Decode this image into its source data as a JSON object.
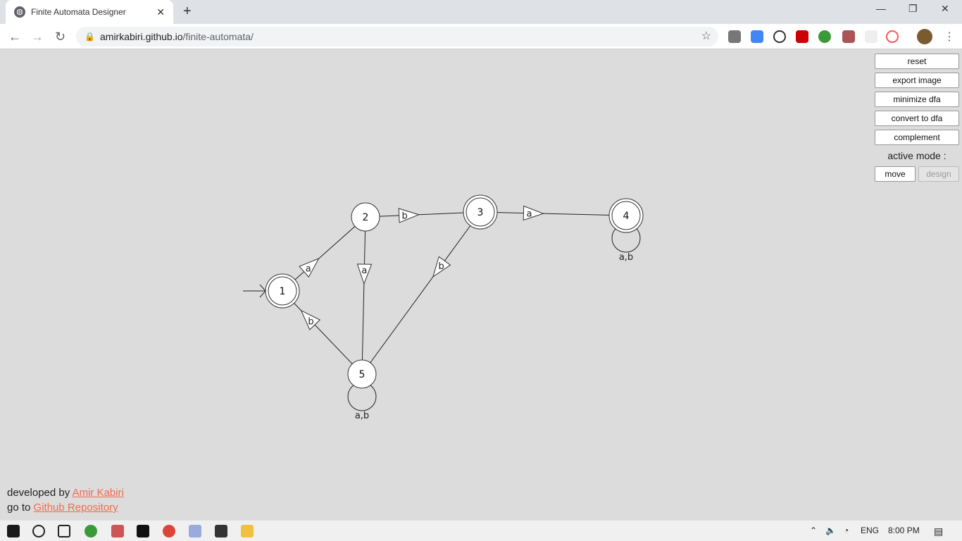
{
  "browser": {
    "tab_title": "Finite Automata Designer",
    "url_host": "amirkabiri.github.io",
    "url_path": "/finite-automata/"
  },
  "controls": {
    "reset": "reset",
    "export_image": "export image",
    "minimize_dfa": "minimize dfa",
    "convert_to_dfa": "convert to dfa",
    "complement": "complement",
    "active_mode_label": "active mode :",
    "move": "move",
    "design": "design",
    "active_mode": "move"
  },
  "footer": {
    "developed_by": "developed by ",
    "author": "Amir Kabiri",
    "go_to": "go to ",
    "repo": "Github Repository"
  },
  "automaton": {
    "start_state": "1",
    "states": [
      {
        "id": "1",
        "accepting": true
      },
      {
        "id": "2",
        "accepting": false
      },
      {
        "id": "3",
        "accepting": true
      },
      {
        "id": "4",
        "accepting": true
      },
      {
        "id": "5",
        "accepting": false
      }
    ],
    "transitions": [
      {
        "from": "1",
        "to": "2",
        "label": "a"
      },
      {
        "from": "2",
        "to": "3",
        "label": "b"
      },
      {
        "from": "2",
        "to": "5",
        "label": "a"
      },
      {
        "from": "3",
        "to": "4",
        "label": "a"
      },
      {
        "from": "3",
        "to": "5",
        "label": "b"
      },
      {
        "from": "5",
        "to": "1",
        "label": "b"
      },
      {
        "from": "4",
        "to": "4",
        "label": "a,b"
      },
      {
        "from": "5",
        "to": "5",
        "label": "a,b"
      }
    ]
  },
  "taskbar": {
    "language": "ENG",
    "time": "8:00 PM"
  }
}
